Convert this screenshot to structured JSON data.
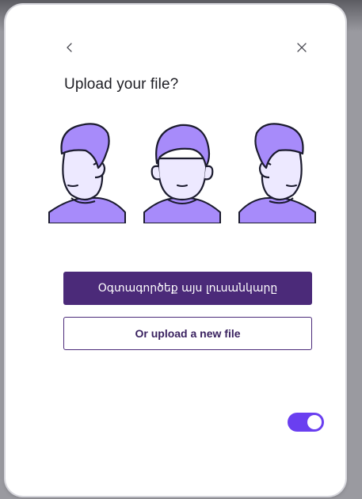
{
  "dialog": {
    "title": "Upload your file?",
    "back_icon": "chevron-left-icon",
    "close_icon": "close-icon"
  },
  "avatars": [
    {
      "name": "avatar-left-profile",
      "pose": "facing-left"
    },
    {
      "name": "avatar-front",
      "pose": "front"
    },
    {
      "name": "avatar-right-profile",
      "pose": "facing-right"
    }
  ],
  "actions": {
    "primary_label": "Օգտագործեք այս լուսանկարը",
    "secondary_label": "Or upload a new file"
  },
  "toggle": {
    "state": "on"
  },
  "colors": {
    "primary": "#4b2a79",
    "toggle": "#6a3ff0",
    "hair": "#a78bfa",
    "shirt": "#a78bfa",
    "skin": "#ede9ff"
  }
}
